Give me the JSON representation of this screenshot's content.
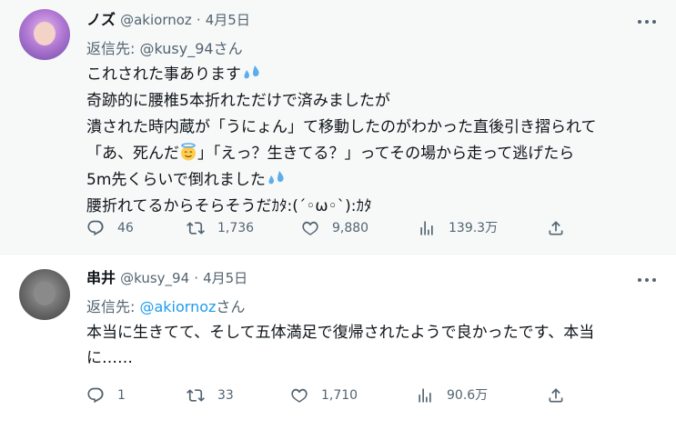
{
  "tweets": [
    {
      "name": "ノズ",
      "handle": "@akiornoz",
      "separator": "·",
      "date": "4月5日",
      "reply_prefix": "返信先: ",
      "reply_mention": "@kusy_94",
      "reply_suffix": "さん",
      "lines": [
        "これされた事あります",
        "奇跡的に腰椎5本折れただけで済みましたが",
        "潰された時内蔵が「うにょん」て移動したのがわかった直後引き摺られて",
        "「あ、死んだ",
        "」「えっ？生きてる？」ってその場から走って逃げたら",
        "5m先くらいで倒れました",
        "腰折れてるからそらそうだｶﾀ:(´◦ω◦`):ｶﾀ"
      ],
      "emoji": [
        "sweat-droplets-icon",
        "halo-face-icon"
      ],
      "stats": {
        "replies": "46",
        "retweets": "1,736",
        "likes": "9,880",
        "views": "139.3万"
      }
    },
    {
      "name": "串井",
      "handle": "@kusy_94",
      "separator": "·",
      "date": "4月5日",
      "reply_prefix": "返信先: ",
      "reply_mention": "@akiornoz",
      "reply_suffix": "さん",
      "lines": [
        "本当に生きてて、そして五体満足で復帰されたようで良かったです、本当",
        "に……"
      ],
      "stats": {
        "replies": "1",
        "retweets": "33",
        "likes": "1,710",
        "views": "90.6万"
      }
    }
  ],
  "colors": {
    "text": "#0f1419",
    "muted": "#536471",
    "link": "#1d9bf0",
    "highlight_bg": "#f7f9f9"
  }
}
